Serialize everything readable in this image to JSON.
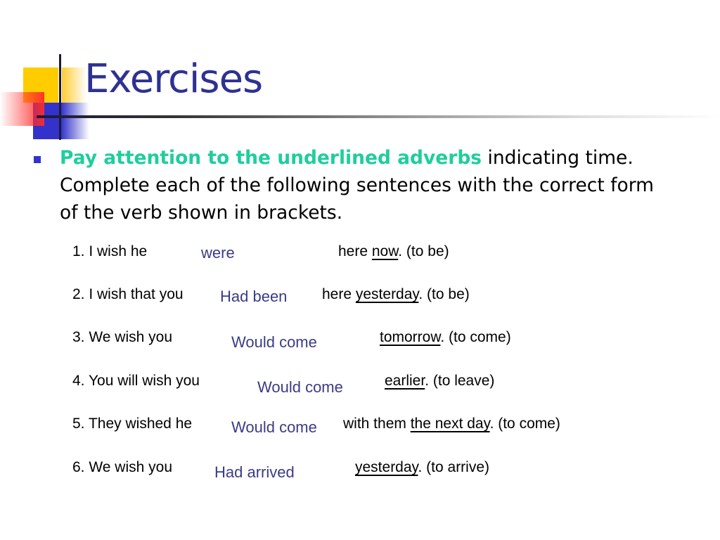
{
  "slide": {
    "title": "Exercises",
    "instruction": {
      "highlight": "Pay attention to the underlined adverbs",
      "rest_line1": " indicating time.",
      "line2": "Complete each of the following sentences with the correct form",
      "line3": "of the verb shown in brackets."
    },
    "colors": {
      "title": "#2e3192",
      "highlight": "#1fce9c",
      "answer": "#3b3b86",
      "bullet": "#3333cc"
    },
    "exercises": [
      {
        "prefix": "1. I wish he",
        "answer": "were",
        "mid": "here ",
        "adverb": "now",
        "suffix": ". (to be)"
      },
      {
        "prefix": "2. I wish that you",
        "answer": "Had been",
        "mid": "here ",
        "adverb": "yesterday",
        "suffix": ". (to be)"
      },
      {
        "prefix": "3. We wish you",
        "answer": "Would come",
        "mid": "",
        "adverb": "tomorrow",
        "suffix": ". (to come)"
      },
      {
        "prefix": "4. You will wish you",
        "answer": "Would come",
        "mid": "",
        "adverb": "earlier",
        "suffix": ". (to leave)"
      },
      {
        "prefix": "5. They wished he",
        "answer": "Would come",
        "mid": "with them ",
        "adverb": "the next day",
        "suffix": ". (to come)"
      },
      {
        "prefix": "6. We wish you",
        "answer": "Had arrived",
        "mid": "",
        "adverb": "yesterday",
        "suffix": ". (to arrive)"
      }
    ]
  }
}
